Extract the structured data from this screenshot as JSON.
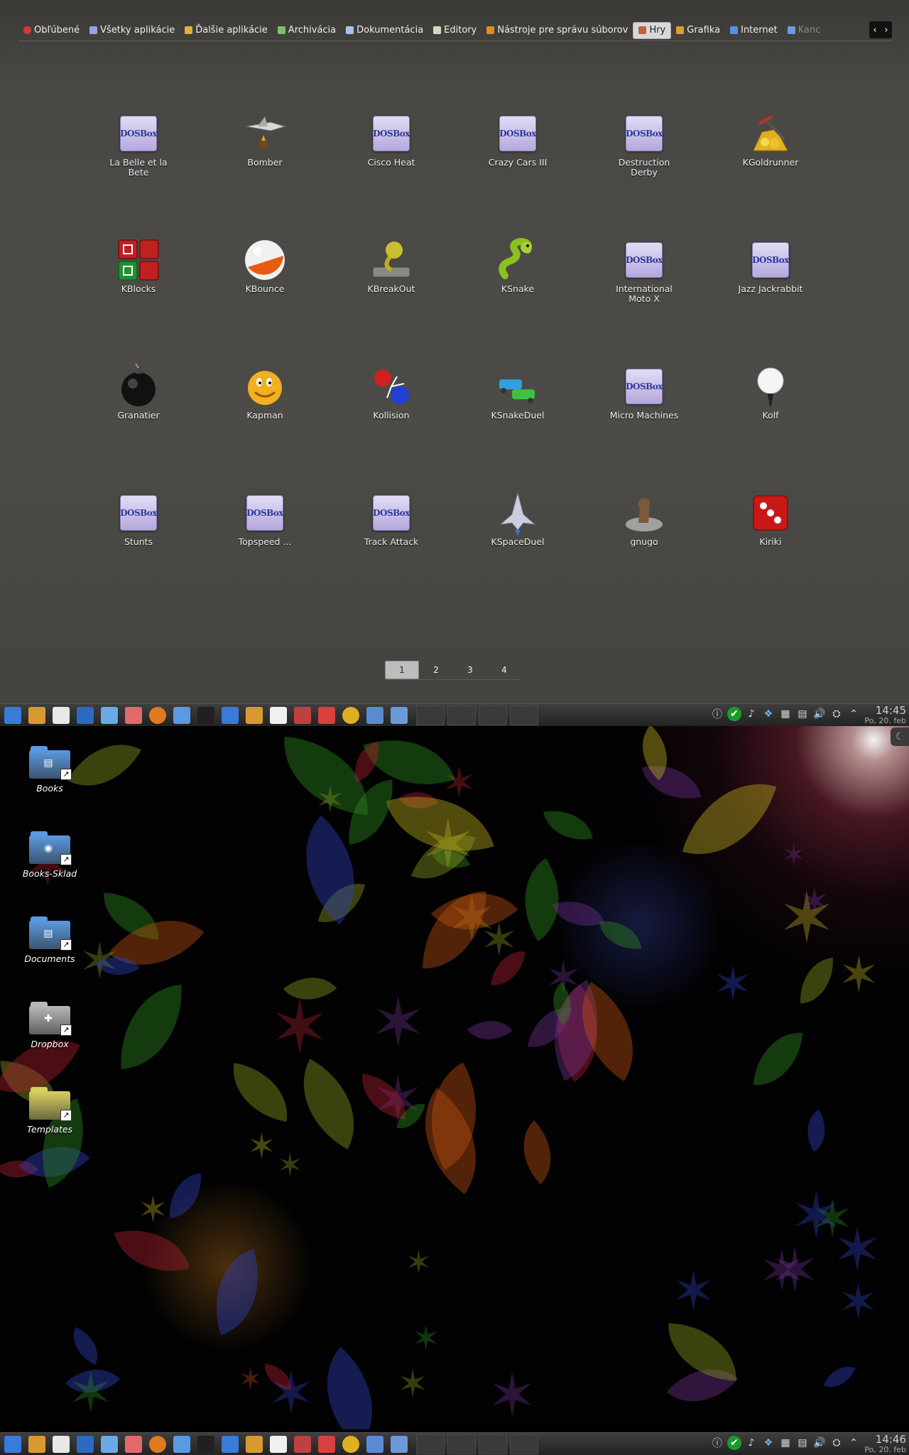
{
  "launcher": {
    "categories": [
      {
        "label": "Obľúbené",
        "icon": "heart-icon",
        "color": "#d23a3a"
      },
      {
        "label": "Všetky aplikácie",
        "icon": "apps-icon",
        "color": "#8fa8d8"
      },
      {
        "label": "Ďalšie aplikácie",
        "icon": "more-apps-icon",
        "color": "#e0b040"
      },
      {
        "label": "Archivácia",
        "icon": "archive-icon",
        "color": "#7cc06a"
      },
      {
        "label": "Dokumentácia",
        "icon": "docs-icon",
        "color": "#a8c4ec"
      },
      {
        "label": "Editory",
        "icon": "editor-icon",
        "color": "#d8d8c0"
      },
      {
        "label": "Nástroje pre správu súborov",
        "icon": "file-tools-icon",
        "color": "#e08a2a"
      },
      {
        "label": "Hry",
        "icon": "games-icon",
        "color": "#c06040"
      },
      {
        "label": "Grafika",
        "icon": "graphics-icon",
        "color": "#d8a030"
      },
      {
        "label": "Internet",
        "icon": "globe-icon",
        "color": "#5a90e0"
      },
      {
        "label": "Kanc",
        "icon": "office-icon",
        "color": "#6a9ae0"
      }
    ],
    "active_category": "Hry",
    "scroll_left": "‹",
    "scroll_right": "›",
    "apps": [
      {
        "label": "La Belle et la Bete",
        "icon": "dosbox"
      },
      {
        "label": "Bomber",
        "icon": "bomber"
      },
      {
        "label": "Cisco Heat",
        "icon": "dosbox"
      },
      {
        "label": "Crazy Cars III",
        "icon": "dosbox"
      },
      {
        "label": "Destruction Derby",
        "icon": "dosbox"
      },
      {
        "label": "KGoldrunner",
        "icon": "kgoldrunner"
      },
      {
        "label": "KBlocks",
        "icon": "kblocks"
      },
      {
        "label": "KBounce",
        "icon": "kbounce"
      },
      {
        "label": "KBreakOut",
        "icon": "kbreakout"
      },
      {
        "label": "KSnake",
        "icon": "ksnake"
      },
      {
        "label": "International Moto X",
        "icon": "dosbox"
      },
      {
        "label": "Jazz Jackrabbit",
        "icon": "dosbox"
      },
      {
        "label": "Granatier",
        "icon": "granatier"
      },
      {
        "label": "Kapman",
        "icon": "kapman"
      },
      {
        "label": "Kollision",
        "icon": "kollision"
      },
      {
        "label": "KSnakeDuel",
        "icon": "ksnakeduel"
      },
      {
        "label": "Micro Machines",
        "icon": "dosbox"
      },
      {
        "label": "Kolf",
        "icon": "kolf"
      },
      {
        "label": "Stunts",
        "icon": "dosbox"
      },
      {
        "label": "Topspeed ...",
        "icon": "dosbox"
      },
      {
        "label": "Track Attack",
        "icon": "dosbox"
      },
      {
        "label": "KSpaceDuel",
        "icon": "kspaceduel"
      },
      {
        "label": "gnugo",
        "icon": "gnugo"
      },
      {
        "label": "Kiriki",
        "icon": "kiriki"
      }
    ],
    "dosbox_text": "DOSBox",
    "pages": [
      "1",
      "2",
      "3",
      "4"
    ],
    "current_page": "1"
  },
  "taskbar_top": {
    "time": "14:45",
    "date": "Po, 20. feb"
  },
  "taskbar_bottom": {
    "time": "14:46",
    "date": "Po, 20. feb"
  },
  "taskbar_launchers": [
    {
      "icon": "kde-menu-icon",
      "color": "#3a7ad8"
    },
    {
      "icon": "settings-icon",
      "color": "#d89a30"
    },
    {
      "icon": "tux-icon",
      "color": "#e8e8e8"
    },
    {
      "icon": "desktop-icon",
      "color": "#2a6ac0"
    },
    {
      "icon": "file-manager-icon",
      "color": "#6aaae8"
    },
    {
      "icon": "archive-icon",
      "color": "#e06a6a"
    },
    {
      "icon": "firefox-icon",
      "color": "#e07a20"
    },
    {
      "icon": "network-icon",
      "color": "#5a9ae0"
    },
    {
      "icon": "terminal-icon",
      "color": "#202020"
    },
    {
      "icon": "krita-icon",
      "color": "#3a7ad8"
    },
    {
      "icon": "image-viewer-icon",
      "color": "#d89a30"
    },
    {
      "icon": "document-icon",
      "color": "#f0f0f0"
    },
    {
      "icon": "books-icon",
      "color": "#c04040"
    },
    {
      "icon": "media-icon",
      "color": "#d84040"
    },
    {
      "icon": "games-icon",
      "color": "#e0b020"
    },
    {
      "icon": "monitor-icon",
      "color": "#5a8ad0"
    },
    {
      "icon": "disk-icon",
      "color": "#6a9ad8"
    }
  ],
  "tray": [
    {
      "icon": "info-icon",
      "glyph": "ⓘ"
    },
    {
      "icon": "check-icon",
      "glyph": "✔"
    },
    {
      "icon": "mixer-icon",
      "glyph": "♪"
    },
    {
      "icon": "dropbox-icon",
      "glyph": "❖"
    },
    {
      "icon": "network-icon",
      "glyph": "▦"
    },
    {
      "icon": "clipboard-icon",
      "glyph": "▤"
    },
    {
      "icon": "volume-icon",
      "glyph": "🔊"
    },
    {
      "icon": "updater-icon",
      "glyph": "⛭"
    },
    {
      "icon": "expand-tray-icon",
      "glyph": "⌃"
    }
  ],
  "desktop": {
    "icons": [
      {
        "label": "Books",
        "color": "#5a9ae0",
        "emblem": "▤"
      },
      {
        "label": "Books-Sklad",
        "color": "#5a9ae0",
        "emblem": "◉"
      },
      {
        "label": "Documents",
        "color": "#5a9ae0",
        "emblem": "▤"
      },
      {
        "label": "Dropbox",
        "color": "#b8b8b8",
        "emblem": "✚"
      },
      {
        "label": "Templates",
        "color": "#d8d060",
        "emblem": ""
      }
    ],
    "link_badge": "↗"
  }
}
